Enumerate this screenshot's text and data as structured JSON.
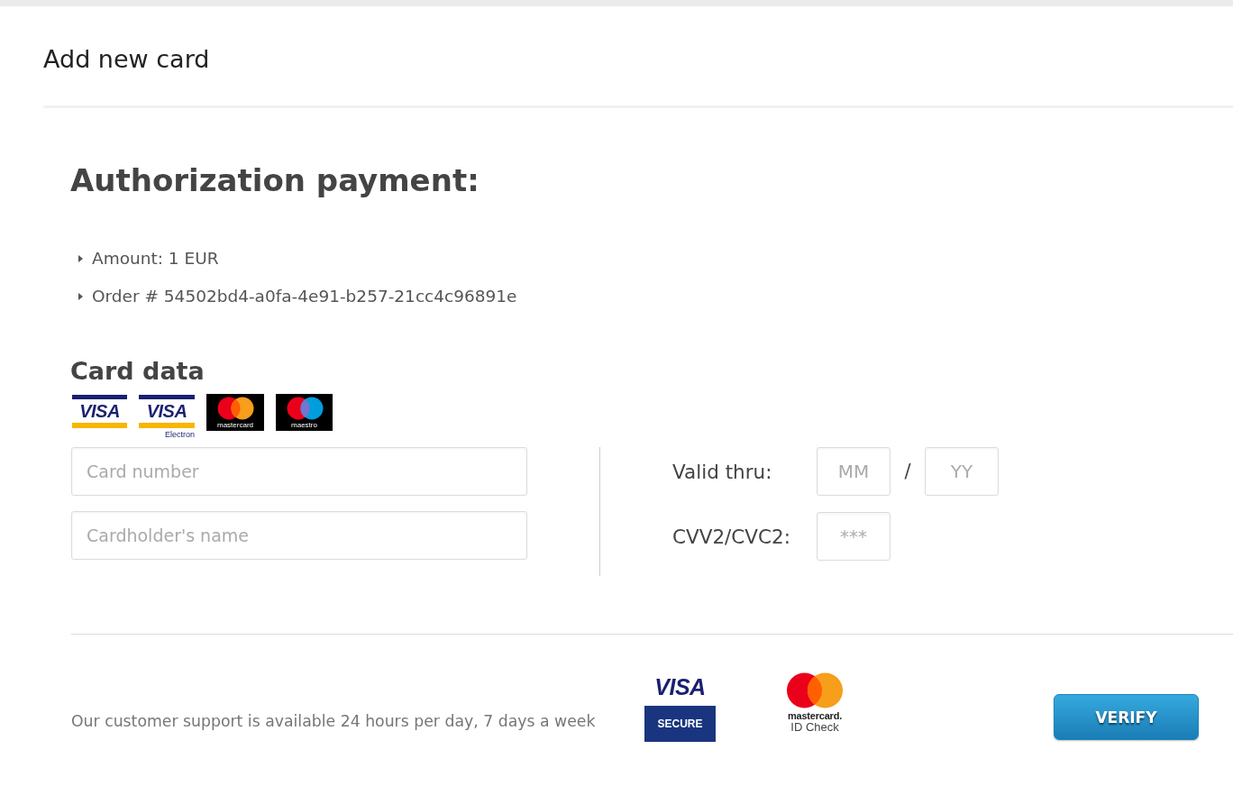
{
  "header": {
    "title": "Add new card"
  },
  "authorization": {
    "heading": "Authorization payment:",
    "details": [
      "Amount: 1 EUR",
      "Order # 54502bd4-a0fa-4e91-b257-21cc4c96891e"
    ]
  },
  "card_data": {
    "heading": "Card data",
    "brands": [
      {
        "kind": "visa",
        "label": "VISA"
      },
      {
        "kind": "visa_electron",
        "label": "VISA",
        "caption": "Electron"
      },
      {
        "kind": "mastercard",
        "label": "mastercard"
      },
      {
        "kind": "maestro",
        "label": "maestro"
      }
    ],
    "card_number": {
      "placeholder": "Card number"
    },
    "cardholder_name": {
      "placeholder": "Cardholder's name"
    },
    "valid_thru": {
      "label": "Valid thru:",
      "month": {
        "placeholder": "MM"
      },
      "separator": "/",
      "year": {
        "placeholder": "YY"
      }
    },
    "cvv": {
      "label": "CVV2/CVC2:",
      "placeholder": "***"
    }
  },
  "footer": {
    "support_text": "Our customer support is available 24 hours per day, 7 days a week",
    "badges": [
      {
        "kind": "visa_secure",
        "label": "VISA",
        "caption": "SECURE"
      },
      {
        "kind": "mastercard_id_check",
        "label": "mastercard.",
        "caption": "ID Check"
      }
    ],
    "verify_button": "VERIFY"
  }
}
